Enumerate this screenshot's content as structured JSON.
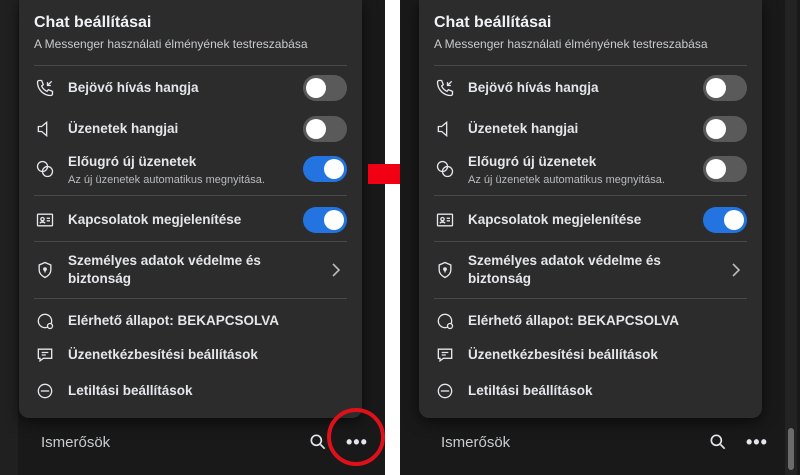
{
  "menu": {
    "title": "Chat beállításai",
    "subtitle": "A Messenger használati élményének testreszabása",
    "items": {
      "incoming_call": {
        "label": "Bejövő hívás hangja",
        "icon": "phone-incoming-icon"
      },
      "message_sounds": {
        "label": "Üzenetek hangjai",
        "icon": "speaker-icon"
      },
      "popup": {
        "label": "Előugró új üzenetek",
        "sublabel": "Az új üzenetek automatikus megnyitása.",
        "icon": "chat-bubbles-icon"
      },
      "contacts": {
        "label": "Kapcsolatok megjelenítése",
        "icon": "contact-card-icon"
      },
      "privacy": {
        "label": "Személyes adatok védelme és biztonság",
        "icon": "shield-icon"
      },
      "active_status": {
        "label": "Elérhető állapot: BEKAPCSOLVA",
        "icon": "active-status-icon"
      },
      "delivery": {
        "label": "Üzenetkézbesítési beállítások",
        "icon": "message-delivery-icon"
      },
      "blocking": {
        "label": "Letiltási beállítások",
        "icon": "block-icon"
      }
    }
  },
  "panels": {
    "left": {
      "incoming_call": false,
      "message_sounds": false,
      "popup": true,
      "contacts": true
    },
    "right": {
      "incoming_call": false,
      "message_sounds": false,
      "popup": false,
      "contacts": true
    }
  },
  "bottom": {
    "title": "Ismerősök",
    "search_icon": "search-icon",
    "more_icon": "more-icon",
    "more_label": "•••"
  },
  "colors": {
    "toggle_on": "#2374e1",
    "toggle_off": "#5a5a5a",
    "highlight": "#e0101a"
  }
}
